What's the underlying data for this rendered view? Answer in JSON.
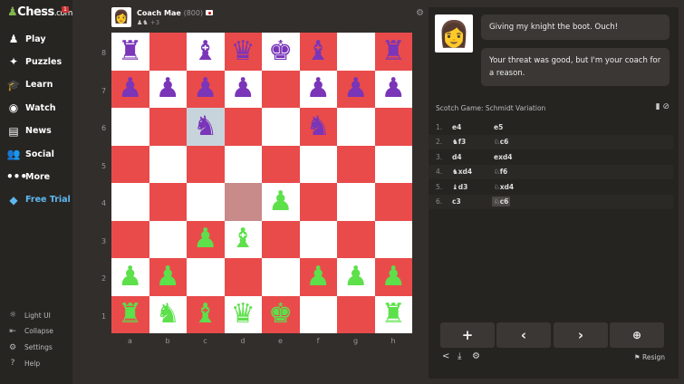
{
  "sidebar": {
    "logo": "Chess",
    "logo_suffix": ".com",
    "badge": "1",
    "items": [
      {
        "label": "Play",
        "icon": "♟"
      },
      {
        "label": "Puzzles",
        "icon": "✦"
      },
      {
        "label": "Learn",
        "icon": "🎓"
      },
      {
        "label": "Watch",
        "icon": "◉"
      },
      {
        "label": "News",
        "icon": "▤"
      },
      {
        "label": "Social",
        "icon": "👥"
      },
      {
        "label": "More",
        "icon": "•••"
      },
      {
        "label": "Free Trial",
        "icon": "◆"
      }
    ],
    "bottom": [
      {
        "label": "Light UI",
        "icon": "☼"
      },
      {
        "label": "Collapse",
        "icon": "⇤"
      },
      {
        "label": "Settings",
        "icon": "⚙"
      },
      {
        "label": "Help",
        "icon": "?"
      }
    ]
  },
  "opponent": {
    "name": "Coach Mae",
    "rating": "(800)",
    "captured": "♟♞",
    "advantage": "+3"
  },
  "board": {
    "ranks": [
      "8",
      "7",
      "6",
      "5",
      "4",
      "3",
      "2",
      "1"
    ],
    "files": [
      "a",
      "b",
      "c",
      "d",
      "e",
      "f",
      "g",
      "h"
    ],
    "rows": [
      [
        "bR",
        "",
        "bB",
        "bQ",
        "bK",
        "bB",
        "",
        "bR"
      ],
      [
        "bP",
        "bP",
        "bP",
        "bP",
        "",
        "bP",
        "bP",
        "bP"
      ],
      [
        "",
        "",
        "bN",
        "",
        "",
        "bN",
        "",
        ""
      ],
      [
        "",
        "",
        "",
        "",
        "",
        "",
        "",
        ""
      ],
      [
        "",
        "",
        "",
        "",
        "wP",
        "",
        "",
        ""
      ],
      [
        "",
        "",
        "wP",
        "wB",
        "",
        "",
        "",
        ""
      ],
      [
        "wP",
        "wP",
        "",
        "",
        "",
        "wP",
        "wP",
        "wP"
      ],
      [
        "wR",
        "wN",
        "wB",
        "wQ",
        "wK",
        "",
        "",
        "wR"
      ]
    ],
    "highlights": [
      "c6",
      "d4"
    ],
    "colors": {
      "light": "#ffffff",
      "dark": "#e94b4b",
      "black_piece": "#7a35b8",
      "white_piece": "#5de04a"
    }
  },
  "coach": {
    "messages": [
      "Giving my knight the boot. Ouch!",
      "Your threat was good, but I'm your coach for a reason."
    ]
  },
  "opening": "Scotch Game: Schmidt Variation",
  "moves": [
    {
      "n": "1.",
      "w": "e4",
      "b": "e5"
    },
    {
      "n": "2.",
      "w": "♞f3",
      "b": "♘c6"
    },
    {
      "n": "3.",
      "w": "d4",
      "b": "exd4"
    },
    {
      "n": "4.",
      "w": "♞xd4",
      "b": "♘f6"
    },
    {
      "n": "5.",
      "w": "♝d3",
      "b": "♘xd4"
    },
    {
      "n": "6.",
      "w": "c3",
      "b": "♘c6"
    }
  ],
  "controls": {
    "add": "+",
    "back": "‹",
    "forward": "›",
    "analyze": "⊕"
  },
  "footer": {
    "resign": "Resign"
  }
}
